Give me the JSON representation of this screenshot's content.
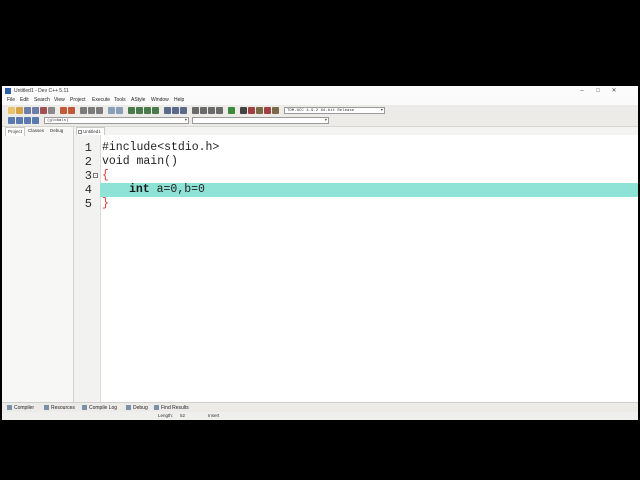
{
  "window": {
    "title": "Untitled1 - Dev C++ 5.11"
  },
  "menu": [
    "File",
    "Edit",
    "Search",
    "View",
    "Project",
    "Execute",
    "Tools",
    "AStyle",
    "Window",
    "Help"
  ],
  "toolbar": {
    "compiler_combo": "TDM-GCC 4.9.2 64-bit Release",
    "scope_combo": "(globals)",
    "symbol_combo": ""
  },
  "panel_tabs": [
    "Project",
    "Classes",
    "Debug"
  ],
  "editor_tab": "Untitled1",
  "line_numbers": [
    "1",
    "2",
    "3",
    "4",
    "5"
  ],
  "code": {
    "l1": "#include<stdio.h>",
    "l2": "void main()",
    "l3": "{",
    "l4_kw": "int",
    "l4_rest": " a=0,b=0",
    "l5": "}"
  },
  "bottom_tabs": [
    "Compiler",
    "Resources",
    "Compile Log",
    "Debug",
    "Find Results"
  ],
  "status": {
    "length_label": "Length:",
    "length_value": "52",
    "mode": "Insert"
  },
  "colors": {
    "current_line": "#8ee3d6",
    "brace": "#d23e35"
  }
}
